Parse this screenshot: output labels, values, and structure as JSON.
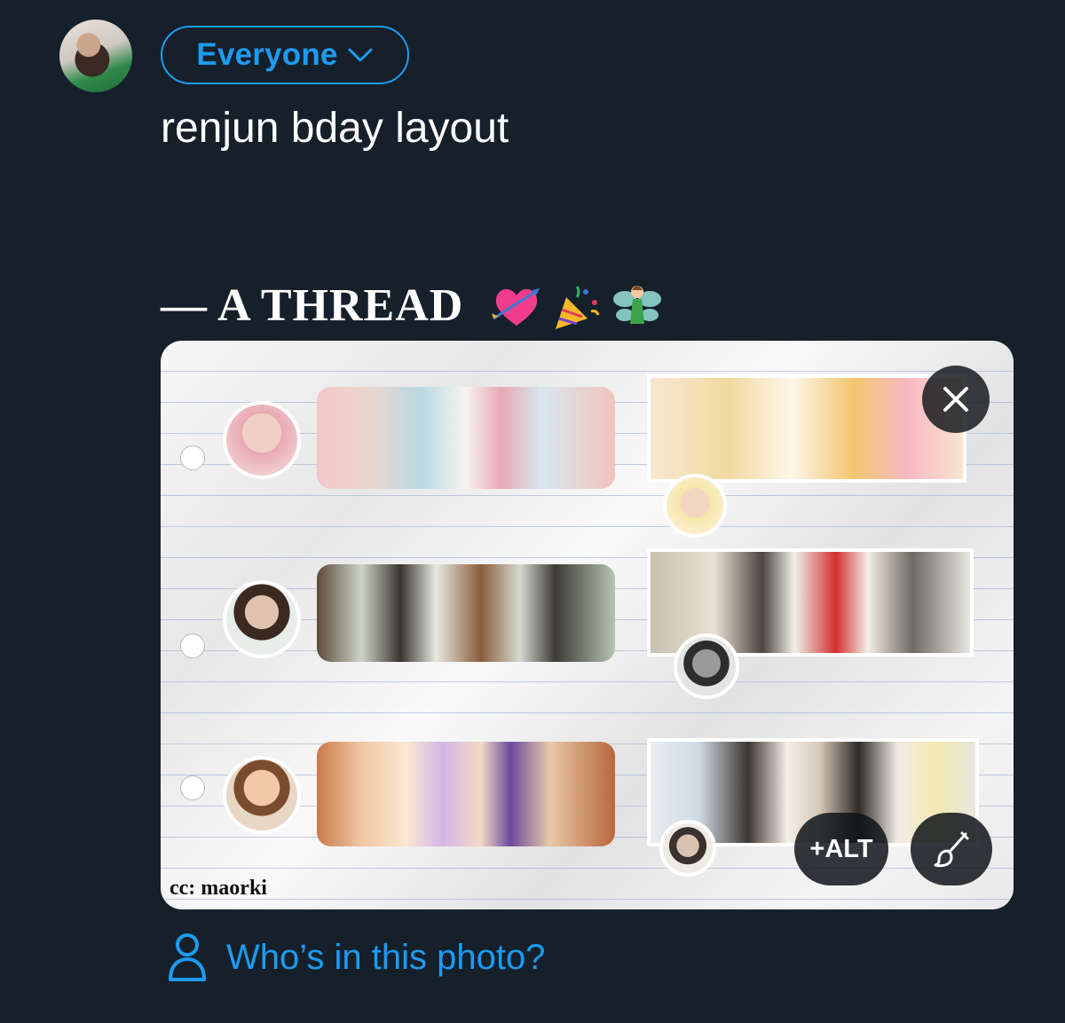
{
  "composer": {
    "audience_label": "Everyone",
    "text_line1": "renjun bday layout",
    "text_line2": "— A THREAD",
    "emojis": [
      "heart-with-arrow-emoji",
      "party-popper-emoji",
      "fairy-emoji"
    ]
  },
  "media": {
    "watermark": "cc: maorki",
    "alt_label": "+ALT",
    "icons": [
      "close-icon",
      "brush-icon"
    ]
  },
  "tag": {
    "label": "Who’s in this photo?",
    "icon": "person-icon"
  },
  "colors": {
    "background": "#15202b",
    "accent": "#1d9bf0",
    "text": "#ffffff"
  }
}
